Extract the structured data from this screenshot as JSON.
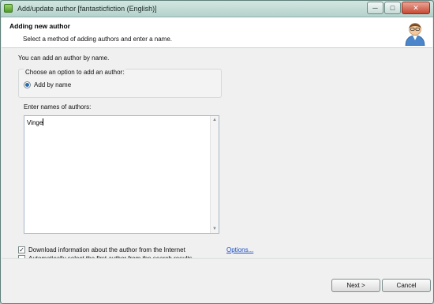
{
  "window": {
    "title": "Add/update author [fantasticfiction (English)]",
    "controls": {
      "minimize": "─",
      "maximize": "□",
      "close": "✕"
    }
  },
  "header": {
    "title": "Adding new author",
    "subtitle": "Select a method of adding authors and enter a name."
  },
  "content": {
    "intro": "You can add an author by name.",
    "option_group": {
      "legend": "Choose an option to add an author:",
      "radio_label": "Add by name",
      "selected": true
    },
    "names_label": "Enter names of authors:",
    "names_value": "Vinge",
    "scroll_up": "▲",
    "scroll_down": "▼",
    "download_info": {
      "label": "Download information about the author from the Internet",
      "checked": true
    },
    "auto_select": {
      "label": "Automatically select the first author from the search results",
      "checked": false
    },
    "options_link": "Options..."
  },
  "footer": {
    "next_label": "Next >",
    "cancel_label": "Cancel"
  }
}
